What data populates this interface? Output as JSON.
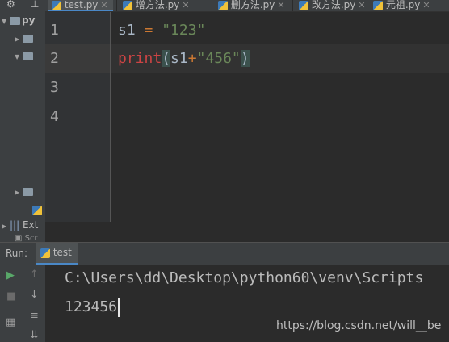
{
  "tabs": [
    {
      "label": "test.py",
      "active": true
    },
    {
      "label": "增方法.py",
      "active": false
    },
    {
      "label": "删方法.py",
      "active": false
    },
    {
      "label": "改方法.py",
      "active": false
    },
    {
      "label": "元祖.py",
      "active": false
    }
  ],
  "project_tree": {
    "root_label": "py",
    "external_label": "Ext",
    "scratches_label": "Scr"
  },
  "editor": {
    "line_numbers": [
      "1",
      "2",
      "3",
      "4"
    ],
    "line1": {
      "var": "s1",
      "op": "=",
      "str": "\"123\""
    },
    "line2": {
      "fn": "print",
      "open": "(",
      "var": "s1",
      "op": "+",
      "str": "\"456\"",
      "close": ")"
    }
  },
  "run_panel": {
    "label": "Run:",
    "tab_label": "test",
    "console_lines": [
      "C:\\Users\\dd\\Desktop\\python60\\venv\\Scripts",
      "123456"
    ]
  },
  "watermark": "https://blog.csdn.net/will__be",
  "colors": {
    "keyword": "#cc7832",
    "string": "#6a8759",
    "builtin": "#cc4444",
    "accent": "#4a88c7"
  }
}
